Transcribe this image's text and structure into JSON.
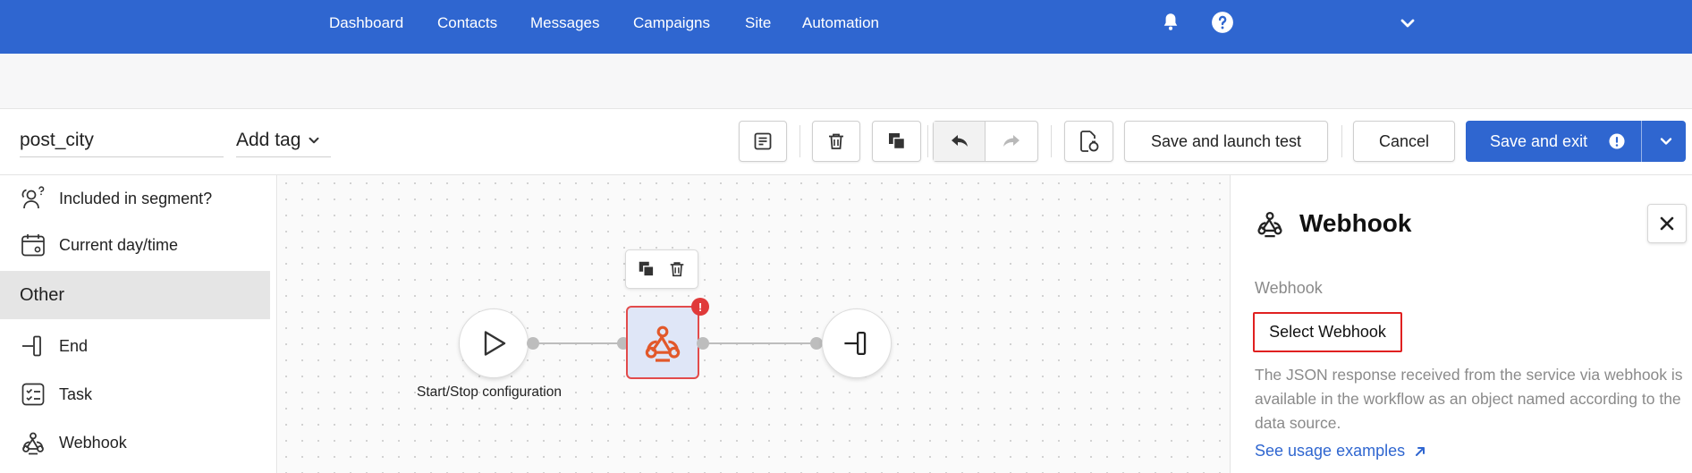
{
  "nav": {
    "items": [
      "Dashboard",
      "Contacts",
      "Messages",
      "Campaigns",
      "Site",
      "Automation"
    ],
    "icons": [
      "bell-icon",
      "help-icon",
      "chevron-down-icon"
    ],
    "color": "#2f66d0"
  },
  "workflow": {
    "name": "post_city",
    "add_tag_label": "Add tag"
  },
  "toolbar": {
    "save_launch_test": "Save and launch test",
    "cancel": "Cancel",
    "save_exit": "Save and exit",
    "icons": [
      "notes-icon",
      "trash-icon",
      "copy-icon",
      "undo-icon",
      "redo-icon",
      "test-icon"
    ]
  },
  "sidebar": {
    "items_top": [
      {
        "label": "Included in segment?",
        "icon": "segment-question-icon"
      },
      {
        "label": "Current day/time",
        "icon": "calendar-clock-icon"
      }
    ],
    "section": "Other",
    "items_other": [
      {
        "label": "End",
        "icon": "end-icon"
      },
      {
        "label": "Task",
        "icon": "task-icon"
      },
      {
        "label": "Webhook",
        "icon": "webhook-icon"
      }
    ]
  },
  "canvas": {
    "start_node_label": "Start/Stop configuration",
    "error_badge": "!"
  },
  "panel": {
    "title": "Webhook",
    "field_label": "Webhook",
    "select_button": "Select Webhook",
    "help_text": "The JSON response received from the service via webhook is available in the workflow as an object named according to the data source.",
    "link_text": "See usage examples",
    "close_icon": "close-icon"
  },
  "colors": {
    "accent": "#2f66d0",
    "webhook_node": "#e2582a",
    "error": "#e03a3a"
  }
}
